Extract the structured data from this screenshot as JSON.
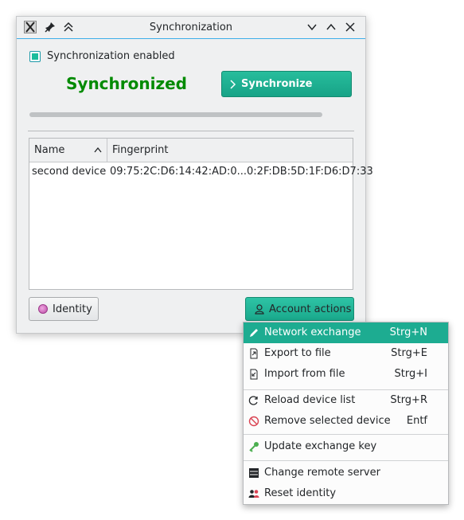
{
  "window": {
    "title": "Synchronization",
    "checkbox_label": "Synchronization enabled",
    "checkbox_checked": true,
    "status_text": "Synchronized",
    "sync_button_label": "Synchronize",
    "progress_fraction": 1.0
  },
  "table": {
    "columns": [
      "Name",
      "Fingerprint"
    ],
    "rows": [
      {
        "name": "second device",
        "fingerprint": "09:75:2C:D6:14:42:AD:0...0:2F:DB:5D:1F:D6:D7:33"
      }
    ]
  },
  "buttons": {
    "identity_label": "Identity",
    "account_actions_label": "Account actions"
  },
  "menu": {
    "items": [
      {
        "label": "Network exchange",
        "shortcut": "Strg+N",
        "icon": "pencil-icon"
      },
      {
        "label": "Export to file",
        "shortcut": "Strg+E",
        "icon": "export-icon"
      },
      {
        "label": "Import from file",
        "shortcut": "Strg+I",
        "icon": "import-icon"
      },
      {
        "label": "Reload device list",
        "shortcut": "Strg+R",
        "icon": "reload-icon"
      },
      {
        "label": "Remove selected device",
        "shortcut": "Entf",
        "icon": "remove-icon"
      },
      {
        "label": "Update exchange key",
        "shortcut": "",
        "icon": "key-icon"
      },
      {
        "label": "Change remote server",
        "shortcut": "",
        "icon": "server-icon"
      },
      {
        "label": "Reset identity",
        "shortcut": "",
        "icon": "reset-identity-icon"
      }
    ]
  },
  "colors": {
    "accent": "#1dac91",
    "status_green": "#008a00",
    "window_bg": "#eff0f1"
  }
}
